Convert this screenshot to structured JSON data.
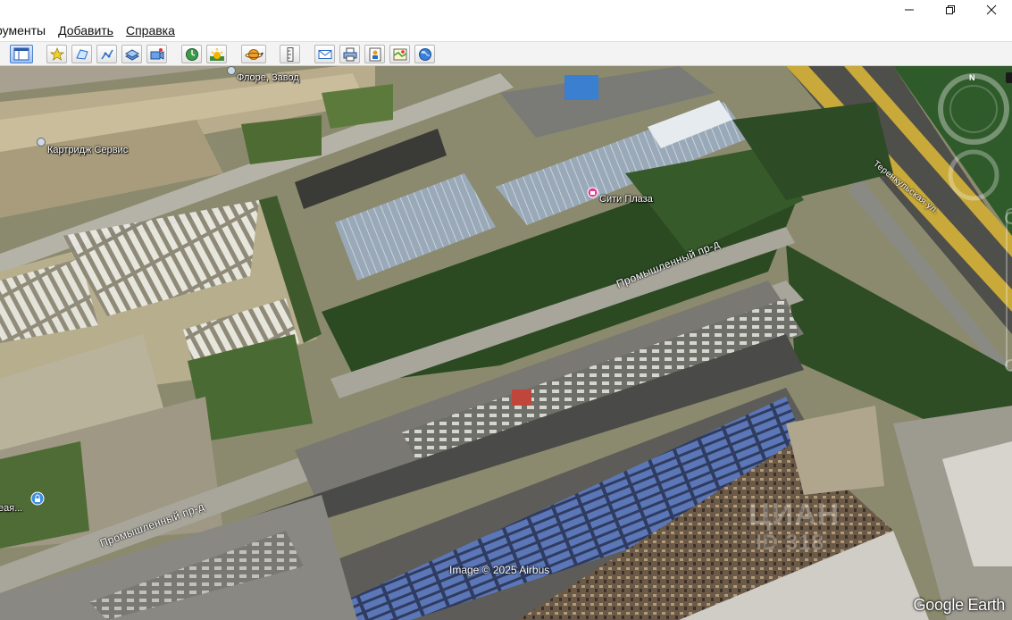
{
  "menu": {
    "items": [
      {
        "label": "рументы"
      },
      {
        "label": "Добавить"
      },
      {
        "label": "Справка"
      }
    ]
  },
  "window": {
    "minimize": "—",
    "maximize": "❐",
    "close": "✕"
  },
  "toolbar": {
    "buttons": [
      "sidebar-toggle-icon",
      "add-placemark-icon",
      "add-polygon-icon",
      "add-path-icon",
      "add-image-overlay-icon",
      "record-tour-icon",
      "historical-imagery-icon",
      "sunlight-icon",
      "planets-icon",
      "ruler-icon",
      "email-icon",
      "print-icon",
      "save-image-icon",
      "view-in-maps-icon",
      "earth-community-icon"
    ]
  },
  "map": {
    "labels": {
      "flora_zavod": "Флоре, Завод",
      "cartridge_service": "Картридж Сервис",
      "city_plaza": "Сити Плаза",
      "truncated_place": "еая...",
      "street_industrial_upper": "Промышленный пр-д",
      "street_industrial_lower": "Промышленный пр-д",
      "street_right": "Теренкульская ул."
    },
    "compass_letter": "N",
    "credit": "Image © 2025 Airbus",
    "logo": "Google Earth",
    "watermark": {
      "text": "ЦИАН",
      "id": "ID 318"
    }
  },
  "colors": {
    "toolbar_bg": "#f3f3f3",
    "pin_blue": "#3a8de0",
    "pin_pink": "#e0408a",
    "road_yellow": "#c8a93a"
  }
}
